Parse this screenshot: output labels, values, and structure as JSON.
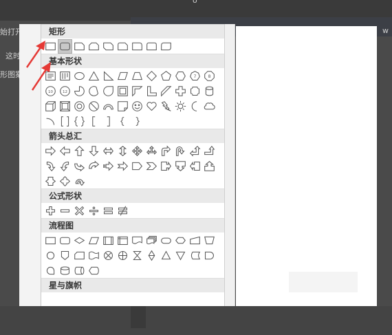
{
  "background": {
    "top_mark": "o",
    "left_snippets": [
      "始打开",
      "这时",
      "形图案"
    ],
    "right_snippet": "w"
  },
  "gallery": {
    "categories": [
      {
        "label": "矩形"
      },
      {
        "label": "基本形状"
      },
      {
        "label": "箭头总汇"
      },
      {
        "label": "公式形状"
      },
      {
        "label": "流程图"
      },
      {
        "label": "星与旗帜"
      }
    ]
  },
  "colors": {
    "annotation_arrow": "#e53935",
    "shape_stroke": "#555555",
    "category_bg": "#e9e9e9"
  }
}
